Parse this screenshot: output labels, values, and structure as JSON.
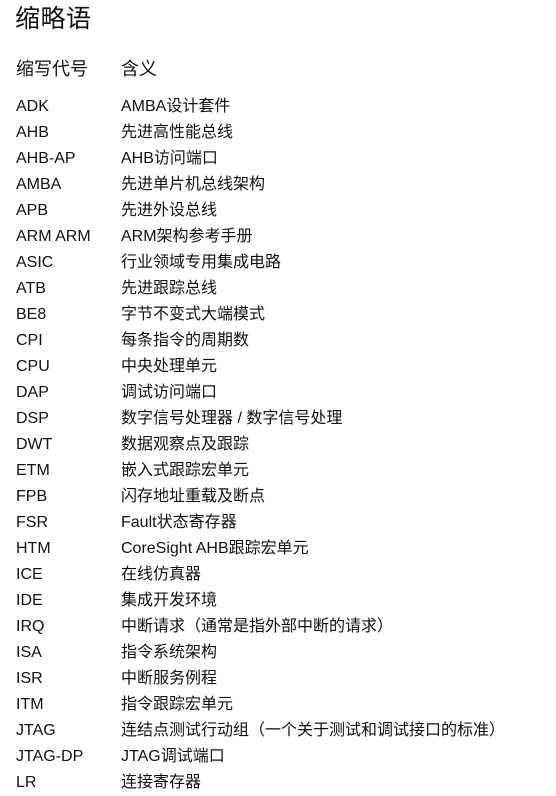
{
  "title": "缩略语",
  "headers": {
    "abbr": "缩写代号",
    "meaning": "含义"
  },
  "rows": [
    {
      "abbr": "ADK",
      "meaning": "AMBA设计套件"
    },
    {
      "abbr": "AHB",
      "meaning": "先进高性能总线"
    },
    {
      "abbr": "AHB-AP",
      "meaning": "AHB访问端口"
    },
    {
      "abbr": "AMBA",
      "meaning": "先进单片机总线架构"
    },
    {
      "abbr": "APB",
      "meaning": "先进外设总线"
    },
    {
      "abbr": "ARM ARM",
      "meaning": "ARM架构参考手册"
    },
    {
      "abbr": "ASIC",
      "meaning": "行业领域专用集成电路"
    },
    {
      "abbr": "ATB",
      "meaning": "先进跟踪总线"
    },
    {
      "abbr": "BE8",
      "meaning": "字节不变式大端模式"
    },
    {
      "abbr": "CPI",
      "meaning": "每条指令的周期数"
    },
    {
      "abbr": "CPU",
      "meaning": "中央处理单元"
    },
    {
      "abbr": "DAP",
      "meaning": "调试访问端口"
    },
    {
      "abbr": "DSP",
      "meaning": "数字信号处理器 / 数字信号处理"
    },
    {
      "abbr": "DWT",
      "meaning": "数据观察点及跟踪"
    },
    {
      "abbr": "ETM",
      "meaning": "嵌入式跟踪宏单元"
    },
    {
      "abbr": "FPB",
      "meaning": "闪存地址重载及断点"
    },
    {
      "abbr": "FSR",
      "meaning": "Fault状态寄存器"
    },
    {
      "abbr": "HTM",
      "meaning": "CoreSight AHB跟踪宏单元"
    },
    {
      "abbr": "ICE",
      "meaning": "在线仿真器"
    },
    {
      "abbr": "IDE",
      "meaning": "集成开发环境"
    },
    {
      "abbr": "IRQ",
      "meaning": "中断请求（通常是指外部中断的请求）"
    },
    {
      "abbr": "ISA",
      "meaning": "指令系统架构"
    },
    {
      "abbr": "ISR",
      "meaning": "中断服务例程"
    },
    {
      "abbr": "ITM",
      "meaning": "指令跟踪宏单元"
    },
    {
      "abbr": "JTAG",
      "meaning": "连结点测试行动组（一个关于测试和调试接口的标准）"
    },
    {
      "abbr": "JTAG-DP",
      "meaning": "JTAG调试端口"
    },
    {
      "abbr": "LR",
      "meaning": "连接寄存器"
    }
  ]
}
